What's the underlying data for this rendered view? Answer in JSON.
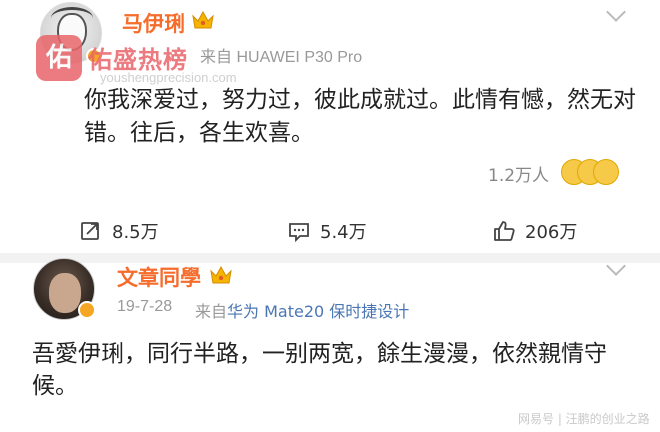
{
  "post1": {
    "author": "马伊琍",
    "source_prefix": "来自",
    "source_device": "HUAWEI P30 Pro",
    "content": "你我深爱过，努力过，彼此成就过。此情有憾，然无对错。往后，各生欢喜。",
    "likes_count": "1.2万人",
    "actions": {
      "repost": "8.5万",
      "comment": "5.4万",
      "like": "206万"
    }
  },
  "watermark": {
    "icon_char": "佑",
    "brand": "佑盛热榜",
    "url": "youshengprecision.com"
  },
  "post2": {
    "author": "文章同學",
    "date": "19-7-28",
    "source_prefix": "来自",
    "source_device": "华为 Mate20 保时捷设计",
    "content": "吾愛伊琍，同行半路，一别两宽，餘生漫漫，依然親情守候。"
  },
  "footer": {
    "watermark": "网易号 | 汪鹏的创业之路"
  },
  "colors": {
    "name": "#f56c2b",
    "watermark": "#e8656a",
    "device_link": "#4a77b4"
  }
}
